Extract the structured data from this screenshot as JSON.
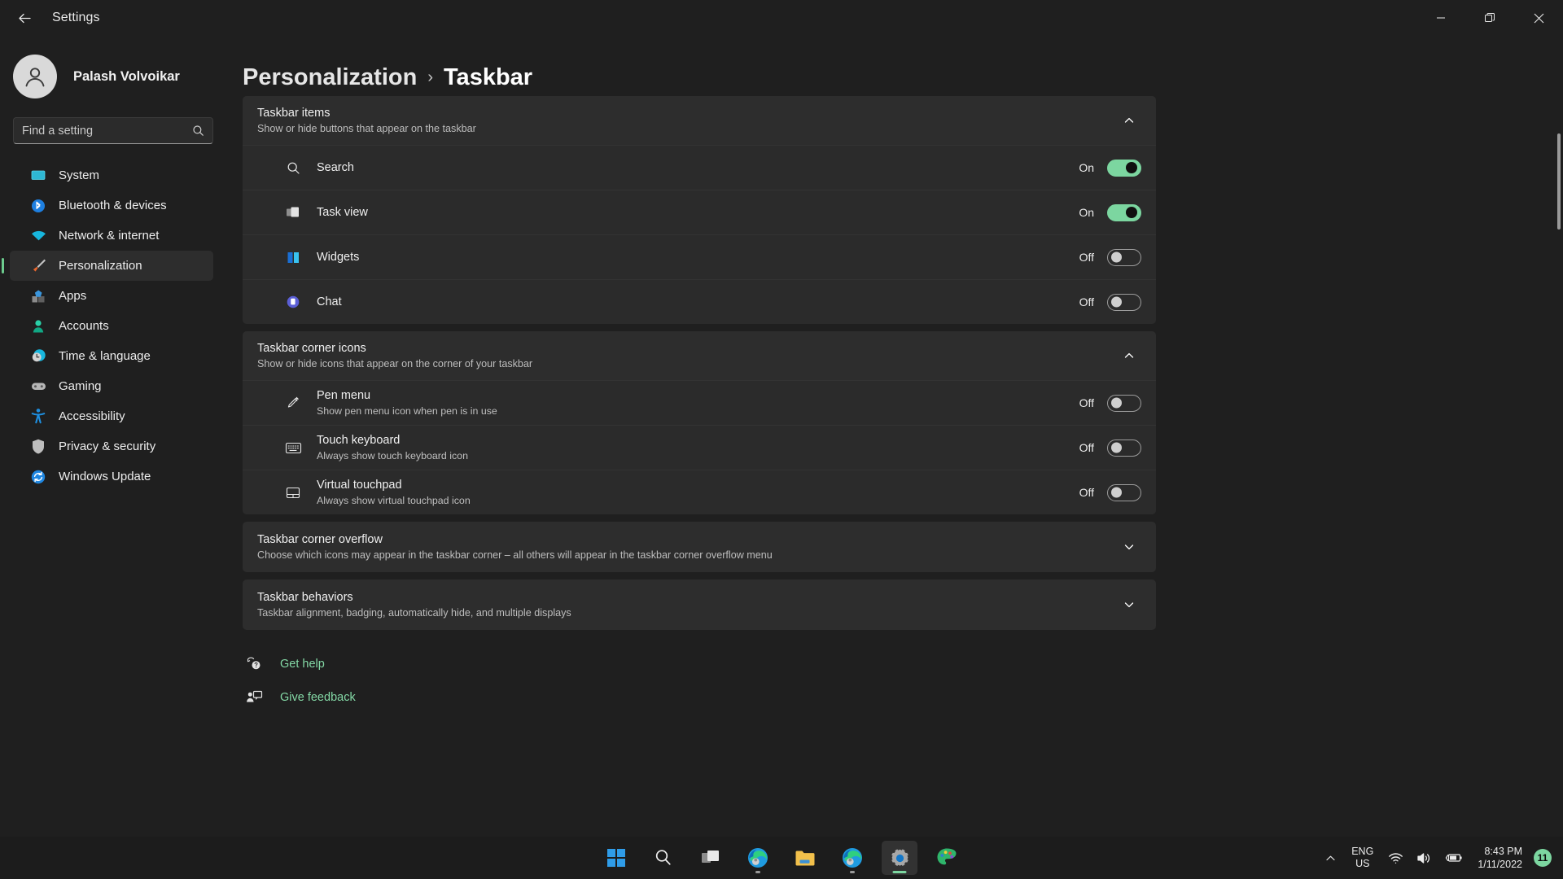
{
  "window": {
    "title": "Settings",
    "back_label": "Back",
    "minimize_label": "Minimize",
    "maximize_label": "Restore",
    "close_label": "Close"
  },
  "sidebar": {
    "profile": {
      "name": "Palash Volvoikar"
    },
    "search": {
      "placeholder": "Find a setting",
      "value": ""
    },
    "items": [
      {
        "label": "System",
        "icon": "monitor-icon",
        "active": false
      },
      {
        "label": "Bluetooth & devices",
        "icon": "bluetooth-icon",
        "active": false
      },
      {
        "label": "Network & internet",
        "icon": "wifi-icon",
        "active": false
      },
      {
        "label": "Personalization",
        "icon": "paintbrush-icon",
        "active": true
      },
      {
        "label": "Apps",
        "icon": "apps-icon",
        "active": false
      },
      {
        "label": "Accounts",
        "icon": "person-icon",
        "active": false
      },
      {
        "label": "Time & language",
        "icon": "clock-icon",
        "active": false
      },
      {
        "label": "Gaming",
        "icon": "gamepad-icon",
        "active": false
      },
      {
        "label": "Accessibility",
        "icon": "accessibility-icon",
        "active": false
      },
      {
        "label": "Privacy & security",
        "icon": "shield-icon",
        "active": false
      },
      {
        "label": "Windows Update",
        "icon": "update-icon",
        "active": false
      }
    ]
  },
  "breadcrumb": {
    "parent": "Personalization",
    "separator": "›",
    "current": "Taskbar"
  },
  "sections": [
    {
      "id": "taskbar-items",
      "title": "Taskbar items",
      "subtitle": "Show or hide buttons that appear on the taskbar",
      "expanded": true,
      "chevron": "chevron-up-icon",
      "rows": [
        {
          "title": "Search",
          "subtitle": "",
          "icon": "search-icon",
          "state": "On",
          "on": true
        },
        {
          "title": "Task view",
          "subtitle": "",
          "icon": "task-view-icon",
          "state": "On",
          "on": true
        },
        {
          "title": "Widgets",
          "subtitle": "",
          "icon": "widgets-icon",
          "state": "Off",
          "on": false
        },
        {
          "title": "Chat",
          "subtitle": "",
          "icon": "chat-icon",
          "state": "Off",
          "on": false
        }
      ]
    },
    {
      "id": "taskbar-corner-icons",
      "title": "Taskbar corner icons",
      "subtitle": "Show or hide icons that appear on the corner of your taskbar",
      "expanded": true,
      "chevron": "chevron-up-icon",
      "rows": [
        {
          "title": "Pen menu",
          "subtitle": "Show pen menu icon when pen is in use",
          "icon": "pen-icon",
          "state": "Off",
          "on": false
        },
        {
          "title": "Touch keyboard",
          "subtitle": "Always show touch keyboard icon",
          "icon": "keyboard-icon",
          "state": "Off",
          "on": false
        },
        {
          "title": "Virtual touchpad",
          "subtitle": "Always show virtual touchpad icon",
          "icon": "touchpad-icon",
          "state": "Off",
          "on": false
        }
      ]
    },
    {
      "id": "taskbar-corner-overflow",
      "title": "Taskbar corner overflow",
      "subtitle": "Choose which icons may appear in the taskbar corner – all others will appear in the taskbar corner overflow menu",
      "expanded": false,
      "chevron": "chevron-down-icon",
      "rows": []
    },
    {
      "id": "taskbar-behaviors",
      "title": "Taskbar behaviors",
      "subtitle": "Taskbar alignment, badging, automatically hide, and multiple displays",
      "expanded": false,
      "chevron": "chevron-down-icon",
      "rows": []
    }
  ],
  "footer": {
    "links": [
      {
        "label": "Get help",
        "icon": "help-icon"
      },
      {
        "label": "Give feedback",
        "icon": "feedback-icon"
      }
    ]
  },
  "taskbar": {
    "apps": [
      {
        "name": "start-button",
        "icon": "windows-logo-icon",
        "active": false,
        "running": false
      },
      {
        "name": "search-button",
        "icon": "search-icon",
        "active": false,
        "running": false
      },
      {
        "name": "task-view-button",
        "icon": "task-view-icon",
        "active": false,
        "running": false
      },
      {
        "name": "edge-button",
        "icon": "edge-icon",
        "active": false,
        "running": true
      },
      {
        "name": "file-explorer-button",
        "icon": "folder-icon",
        "active": false,
        "running": false
      },
      {
        "name": "edge-dev-button",
        "icon": "edge-icon",
        "active": false,
        "running": true
      },
      {
        "name": "settings-button",
        "icon": "gear-icon",
        "active": true,
        "running": true
      },
      {
        "name": "paint-button",
        "icon": "paint-icon",
        "active": false,
        "running": false
      }
    ],
    "tray": {
      "overflow_icon": "chevron-up-icon",
      "language": {
        "line1": "ENG",
        "line2": "US"
      },
      "network_icon": "wifi-icon",
      "volume_icon": "speaker-icon",
      "battery_icon": "battery-charging-icon",
      "clock": {
        "time": "8:43 PM",
        "date": "1/11/2022"
      },
      "notifications": {
        "count": "11"
      }
    }
  },
  "colors": {
    "accent_green": "#7cd6a0",
    "link_green": "#84d9a6",
    "window_bg": "#1f1f1f",
    "card_bg": "#2b2b2b",
    "taskbar_bg": "#1c1c1c"
  }
}
